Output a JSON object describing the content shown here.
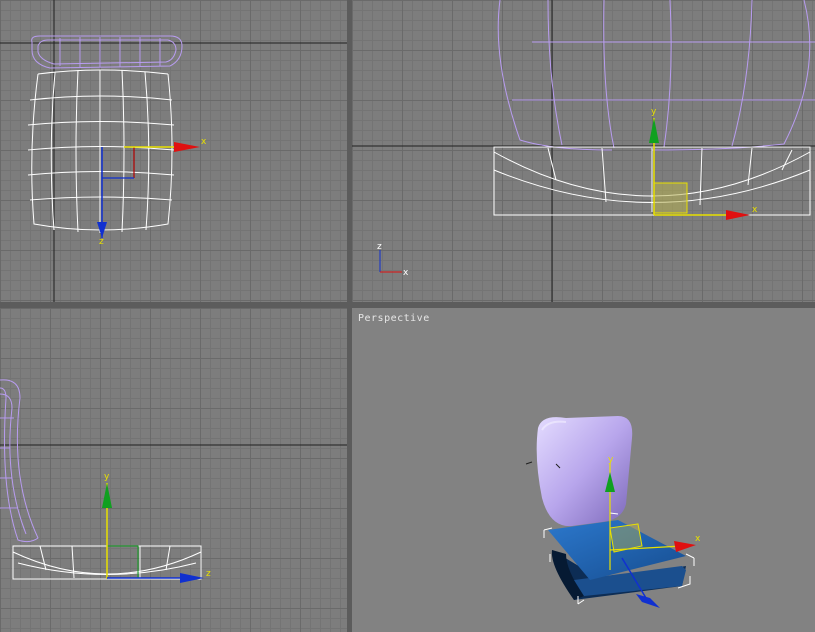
{
  "viewports": {
    "top": {
      "axis_x": "x",
      "axis_y": "z"
    },
    "front": {
      "axis_x": "x",
      "axis_y": "y",
      "corner_x": "x",
      "corner_z": "z"
    },
    "left": {
      "axis_x": "z",
      "axis_y": "y"
    },
    "perspective": {
      "label": "Perspective",
      "axis_x": "x"
    }
  },
  "colors": {
    "background": "#7d7d7d",
    "active_border": "#e8d21c",
    "wire_selected": "#ffffff",
    "wire_back": "#b89cf0",
    "seat_fill": "#1f5fa8",
    "back_fill": "#b8a6ec",
    "axis_x": "#e01010",
    "axis_y": "#10a020",
    "axis_z": "#1030d0",
    "axis_label": "#e8e000"
  }
}
